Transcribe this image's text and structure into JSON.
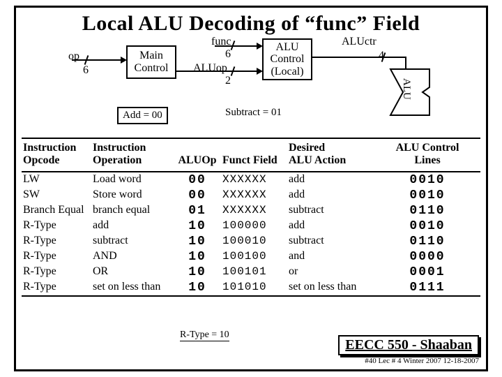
{
  "title": "Local ALU Decoding of “func” Field",
  "diagram": {
    "op_label": "op",
    "op_bits": "6",
    "main_control": "Main\nControl",
    "func_label": "func",
    "func_bits": "6",
    "aluop_label": "ALUop",
    "aluop_bits": "2",
    "alu_control": "ALU\nControl\n(Local)",
    "aluctr_label": "ALUctr",
    "aluctr_bits": "4",
    "alu_label": "ALU",
    "add_note": "Add = 00",
    "subtract_note": "Subtract = 01",
    "rtype_note": "R-Type = 10"
  },
  "headers": {
    "opcode": "Instruction\nOpcode",
    "operation": "Instruction\nOperation",
    "aluop": "ALUOp",
    "funct": "Funct Field",
    "desired": "Desired\nALU Action",
    "ctrl": "ALU Control\nLines"
  },
  "rows": [
    {
      "opcode": "LW",
      "operation": "Load word",
      "aluop": "00",
      "funct": "XXXXXX",
      "action": "add",
      "ctrl": "0010"
    },
    {
      "opcode": "SW",
      "operation": "Store word",
      "aluop": "00",
      "funct": "XXXXXX",
      "action": "add",
      "ctrl": "0010"
    },
    {
      "opcode": "Branch Equal",
      "operation": "branch equal",
      "aluop": "01",
      "funct": "XXXXXX",
      "action": "subtract",
      "ctrl": "0110"
    },
    {
      "opcode": "R-Type",
      "operation": "add",
      "aluop": "10",
      "funct": "100000",
      "action": "add",
      "ctrl": "0010"
    },
    {
      "opcode": "R-Type",
      "operation": "subtract",
      "aluop": "10",
      "funct": "100010",
      "action": "subtract",
      "ctrl": "0110"
    },
    {
      "opcode": "R-Type",
      "operation": "AND",
      "aluop": "10",
      "funct": "100100",
      "action": "and",
      "ctrl": "0000"
    },
    {
      "opcode": "R-Type",
      "operation": "OR",
      "aluop": "10",
      "funct": "100101",
      "action": "or",
      "ctrl": "0001"
    },
    {
      "opcode": "R-Type",
      "operation": "set on less than",
      "aluop": "10",
      "funct": "101010",
      "action": "set on less than",
      "ctrl": "0111"
    }
  ],
  "footer": {
    "course": "EECC 550 - Shaaban",
    "meta": "#40  Lec # 4  Winter 2007  12-18-2007"
  }
}
